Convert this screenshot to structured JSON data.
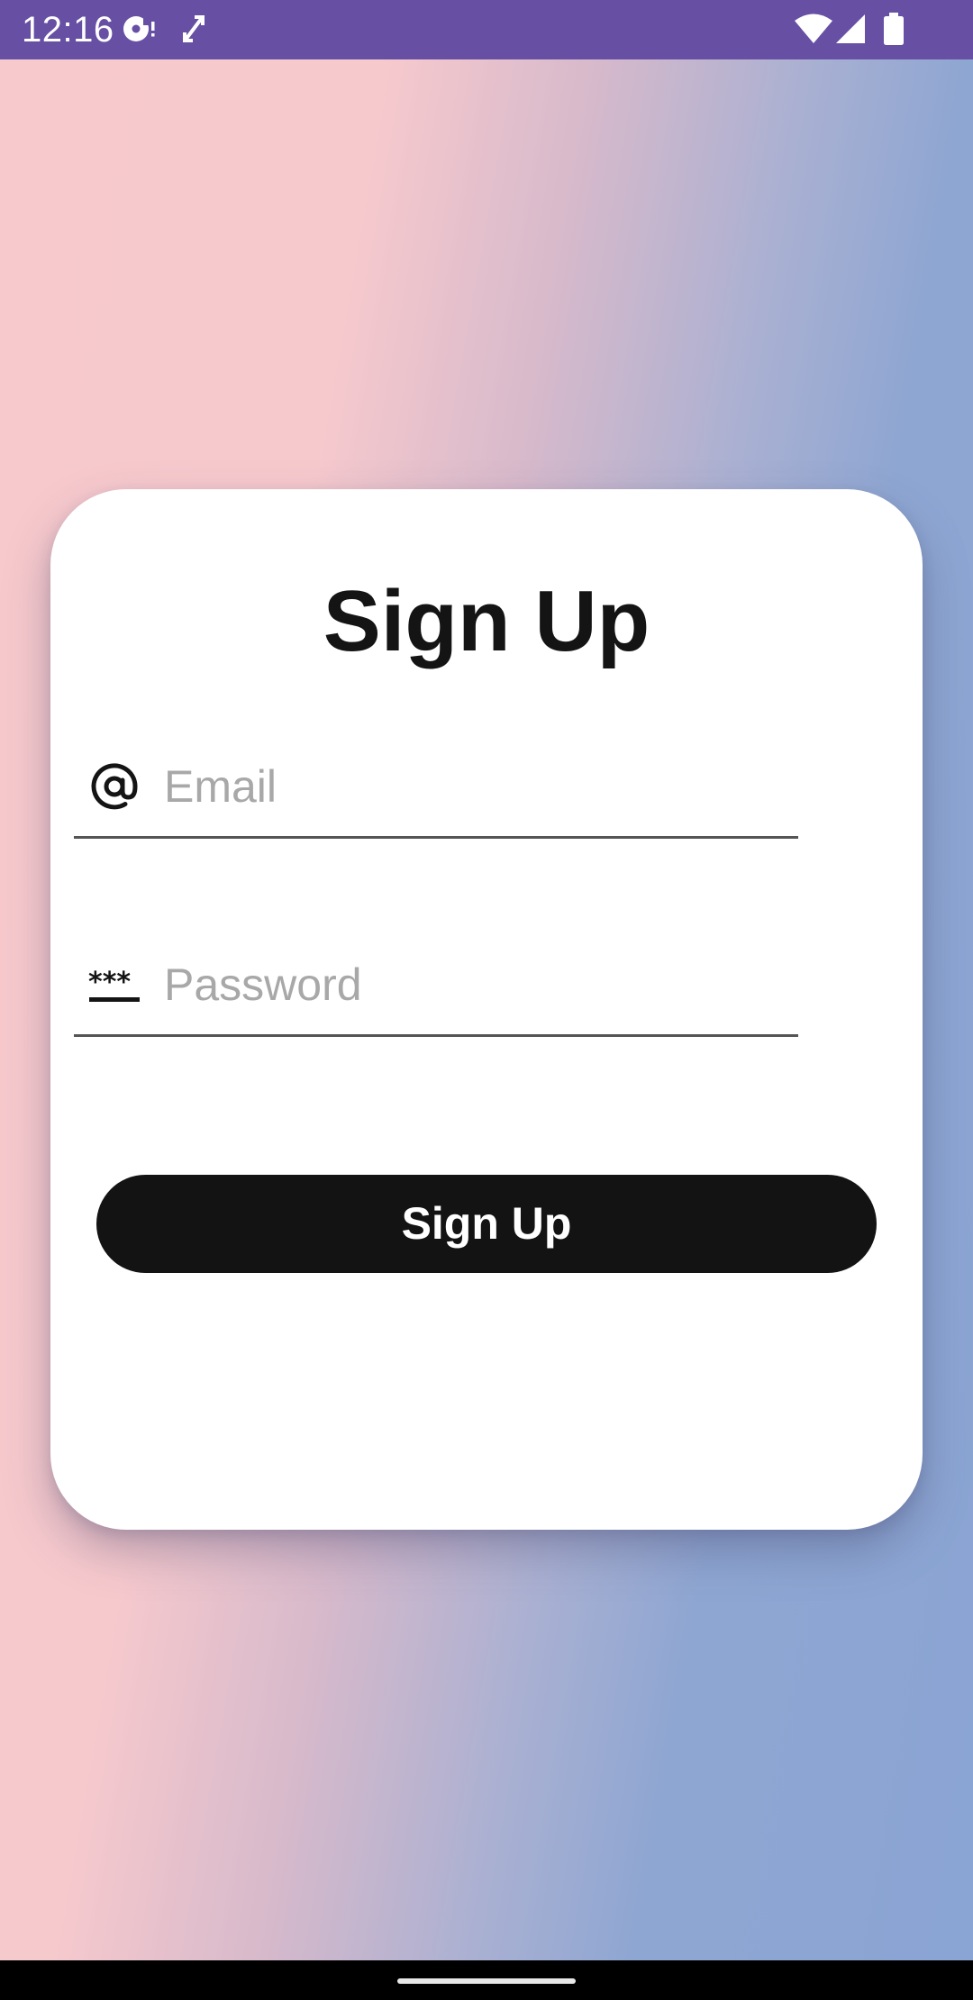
{
  "status_bar": {
    "time": "12:16",
    "background": "#6750a4",
    "icons": [
      "media-notification-icon",
      "screen-rotate-icon",
      "wifi-icon",
      "cellular-signal-icon",
      "battery-icon"
    ]
  },
  "card": {
    "title": "Sign Up",
    "email_field": {
      "placeholder": "Email",
      "value": "",
      "icon": "at-sign-icon"
    },
    "password_field": {
      "placeholder": "Password",
      "value": "",
      "icon": "password-dots-icon"
    },
    "signup_button_label": "Sign Up"
  },
  "colors": {
    "gradient_start": "#f7c9cc",
    "gradient_end": "#8aa4d3",
    "button": "#141314"
  }
}
